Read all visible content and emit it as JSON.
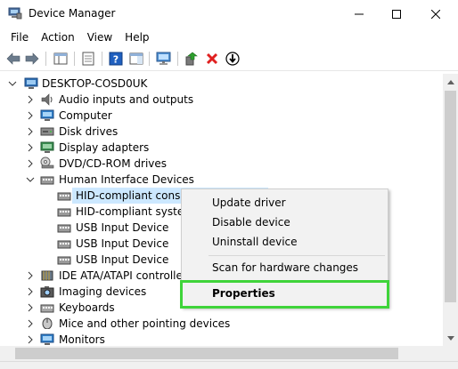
{
  "window": {
    "title": "Device Manager"
  },
  "menu": [
    "File",
    "Action",
    "View",
    "Help"
  ],
  "toolbar": {
    "buttons": [
      "back-icon",
      "forward-icon",
      "show-hide-console-tree-icon",
      "properties-icon",
      "help-icon",
      "action-pane-icon",
      "scan-monitor-icon",
      "update-driver-icon",
      "uninstall-icon",
      "download-icon"
    ]
  },
  "tree": {
    "root": "DESKTOP-COSD0UK",
    "items": [
      {
        "label": "Audio inputs and outputs"
      },
      {
        "label": "Computer"
      },
      {
        "label": "Disk drives"
      },
      {
        "label": "Display adapters"
      },
      {
        "label": "DVD/CD-ROM drives"
      },
      {
        "label": "Human Interface Devices"
      },
      {
        "label": "HID-compliant consu"
      },
      {
        "label": "HID-compliant system"
      },
      {
        "label": "USB Input Device"
      },
      {
        "label": "USB Input Device"
      },
      {
        "label": "USB Input Device"
      },
      {
        "label": "IDE ATA/ATAPI controllers"
      },
      {
        "label": "Imaging devices"
      },
      {
        "label": "Keyboards"
      },
      {
        "label": "Mice and other pointing devices"
      },
      {
        "label": "Monitors"
      }
    ]
  },
  "context_menu": {
    "items": [
      {
        "label": "Update driver"
      },
      {
        "label": "Disable device"
      },
      {
        "label": "Uninstall device"
      },
      {
        "label": "Scan for hardware changes"
      },
      {
        "label": "Properties"
      }
    ],
    "highlight_color": "#3fd43a"
  },
  "colors": {
    "selection": "#cce8ff",
    "menu_bg": "#f2f2f2"
  }
}
